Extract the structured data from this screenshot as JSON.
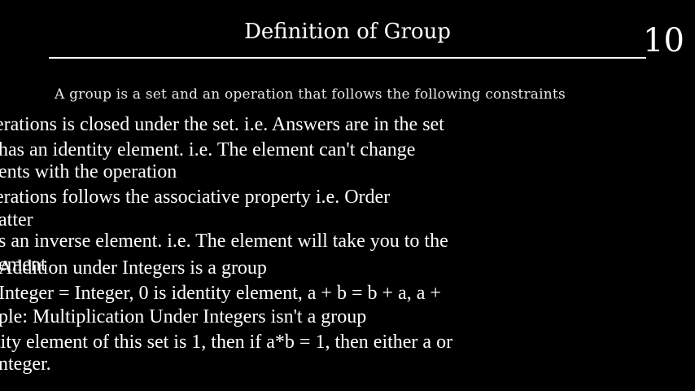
{
  "slide": {
    "title": "Definition of Group",
    "number": "10",
    "intro": "A group is a set and an operation that follows the following constraints"
  },
  "lines": [
    "erations is closed under the set. i.e. Answers are in the set",
    " has an identity element. i.e. The element can't change",
    "ents with the operation",
    "erations follows the associative property i.e. Order",
    "atter",
    "s an inverse element. i.e. The element will take you to the",
    "ement",
    "Addition under Integers is a group",
    "Integer = Integer, 0 is identity element, a + b = b + a, a +",
    "ple: Multiplication Under Integers isn't a group",
    "tity element of this set is 1, then if a*b = 1, then either a or",
    "nteger."
  ]
}
